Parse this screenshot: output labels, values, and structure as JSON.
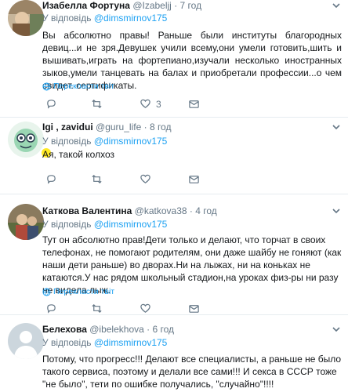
{
  "tweets": [
    {
      "name": "Изабелла Фортуна",
      "handle": "@Izabeljj",
      "time": "7 год",
      "reply_prefix": "У відповідь",
      "reply_to": "@dimsmirnov175",
      "text": "Вы абсолютно правы! Раньше были институты благородных девиц...и не зря.Девушек учили всему,они умели готовить,шить и вышивать,играть на фортепиано,изучали несколько иностранных зыков,умели танцевать на балах и приобретали профессии...о чем свидет. сертификаты.",
      "translate": "Перекласти твіт",
      "likes": "3"
    },
    {
      "name": "Igi , zavidui",
      "handle": "@guru_life",
      "time": "8 год",
      "reply_prefix": "У відповідь",
      "reply_to": "@dimsmirnov175",
      "text": "Ая, такой колхоз",
      "translate": "",
      "likes": ""
    },
    {
      "name": "Каткова Валентина",
      "handle": "@katkova38",
      "time": "4 год",
      "reply_prefix": "У відповідь",
      "reply_to": "@dimsmirnov175",
      "text": "Тут он абсолютно прав!Дети только и делают, что торчат в своих телефонах, не помогают родителям, они даже шайбу не гоняют (как наши дети раньше) во дворах.Ни на лыжах, ни на коньках не катаются.У нас рядом школьный стадион,на уроках физ-ры ни разу не видела лыж.",
      "translate": "Перекласти твіт",
      "likes": ""
    },
    {
      "name": "Белехова",
      "handle": "@ibelekhova",
      "time": "6 год",
      "reply_prefix": "У відповідь",
      "reply_to": "@dimsmirnov175",
      "text": "Потому, что прогресс!!! Делают все специалисты, а раньше не было такого сервиса, поэтому и делали все сами!!! И секса в СССР тоже \"не было\", тети по ошибке получались, \"случайно\"!!!!",
      "translate": "",
      "likes": ""
    }
  ],
  "colors": {
    "accent": "#1da1f2",
    "muted": "#657786",
    "text": "#14171a",
    "border": "#e6ecf0"
  },
  "icons": [
    "reply-icon",
    "retweet-icon",
    "like-icon",
    "dm-icon",
    "chevron-down-icon",
    "globe-icon"
  ]
}
